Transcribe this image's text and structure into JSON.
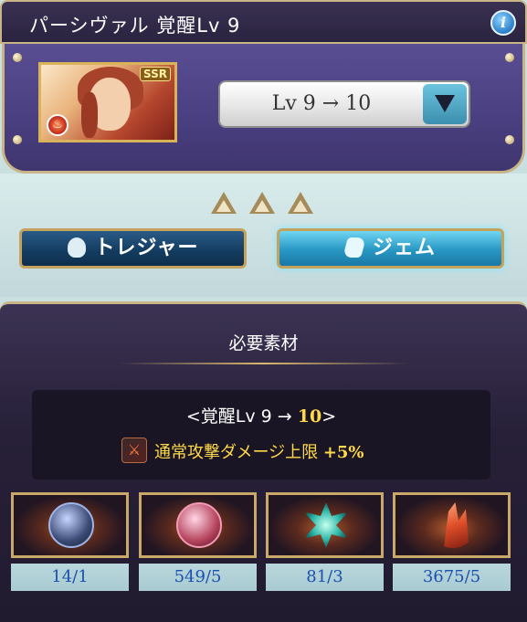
{
  "header": {
    "title": "パーシヴァル 覚醒Lv 9",
    "info_icon": "info-icon"
  },
  "character": {
    "badge": "SSR",
    "element_icon": "fire-icon",
    "level_select": {
      "value": "Lv 9 → 10"
    }
  },
  "tabs": [
    {
      "label": "トレジャー",
      "icon": "treasure-bag-icon",
      "active": false
    },
    {
      "label": "ジェム",
      "icon": "gem-crystal-icon",
      "active": true
    }
  ],
  "materials": {
    "title": "必要素材",
    "awakening": {
      "prefix": "<覚醒Lv 9 → ",
      "to": "10",
      "suffix": ">"
    },
    "bonus": {
      "text": "通常攻撃ダメージ上限 ",
      "value": "+5%"
    },
    "items": [
      {
        "count": "14/1"
      },
      {
        "count": "549/5"
      },
      {
        "count": "81/3"
      },
      {
        "count": "3675/5"
      }
    ]
  },
  "colors": {
    "frame_gold": "#c9b487",
    "panel_purple": "#4a3f80",
    "count_blue": "#1c4fb0",
    "highlight_yellow": "#ffd94a"
  }
}
